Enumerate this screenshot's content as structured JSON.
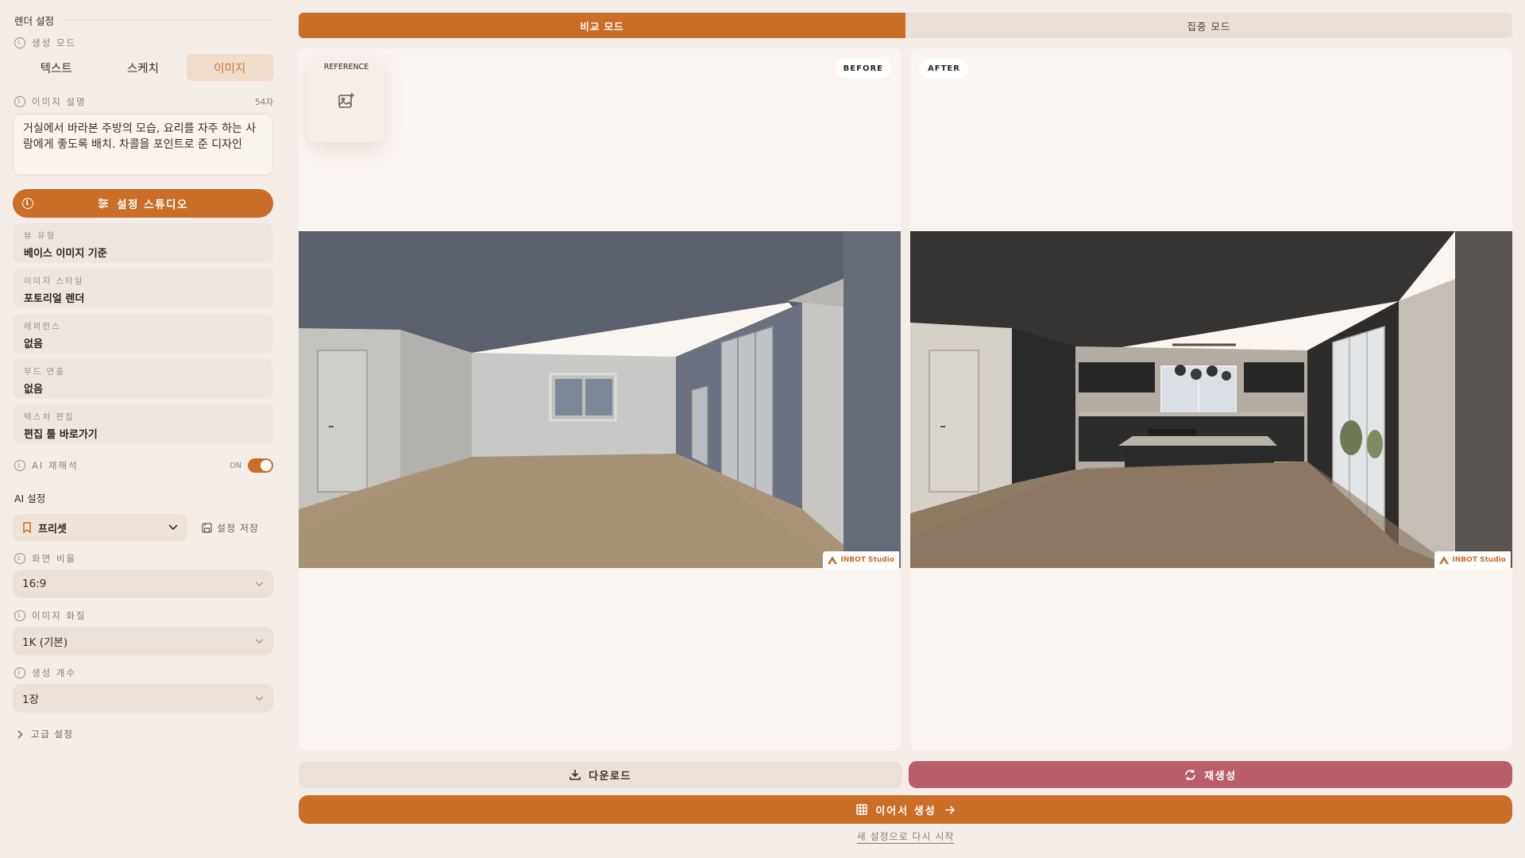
{
  "sidebar": {
    "title": "렌더 설정",
    "gen_mode_label": "생성 모드",
    "gen_modes": [
      "텍스트",
      "스케치",
      "이미지"
    ],
    "active_mode_index": 2,
    "desc_label": "이미지 설명",
    "desc_count": "54자",
    "desc_text": "거실에서 바라본 주방의 모습, 요리를 자주 하는 사람에게 좋도록 배치. 차콜을 포인트로 준 디자인",
    "studio_button": "설정 스튜디오",
    "cards": [
      {
        "label": "뷰 유형",
        "value": "베이스 이미지 기준"
      },
      {
        "label": "이미지 스타일",
        "value": "포토리얼 렌더"
      },
      {
        "label": "레퍼런스",
        "value": "없음"
      },
      {
        "label": "무드 연출",
        "value": "없음"
      },
      {
        "label": "텍스처 편집",
        "value": "편집 툴 바로가기"
      }
    ],
    "ai_reinterpret_label": "AI 재해석",
    "ai_reinterpret_state": "ON",
    "ai_settings_title": "AI 설정",
    "preset_label": "프리셋",
    "save_settings": "설정 저장",
    "aspect_label": "화면 비율",
    "aspect_value": "16:9",
    "quality_label": "이미지 화질",
    "quality_value": "1K (기본)",
    "count_label": "생성 개수",
    "count_value": "1장",
    "advanced_label": "고급 설정"
  },
  "modes": {
    "compare": "비교 모드",
    "focus": "집중 모드",
    "active": "compare"
  },
  "left_panel": {
    "badge": "BEFORE",
    "reference_label": "REFERENCE",
    "watermark": "INBOT Studio"
  },
  "right_panel": {
    "badge": "AFTER",
    "watermark": "INBOT Studio"
  },
  "actions": {
    "download": "다운로드",
    "regenerate": "재생성",
    "continue": "이어서 생성",
    "restart": "새 설정으로 다시 시작"
  },
  "colors": {
    "accent": "#c96d27",
    "regen": "#b95d6d",
    "background": "#f5eee8"
  }
}
